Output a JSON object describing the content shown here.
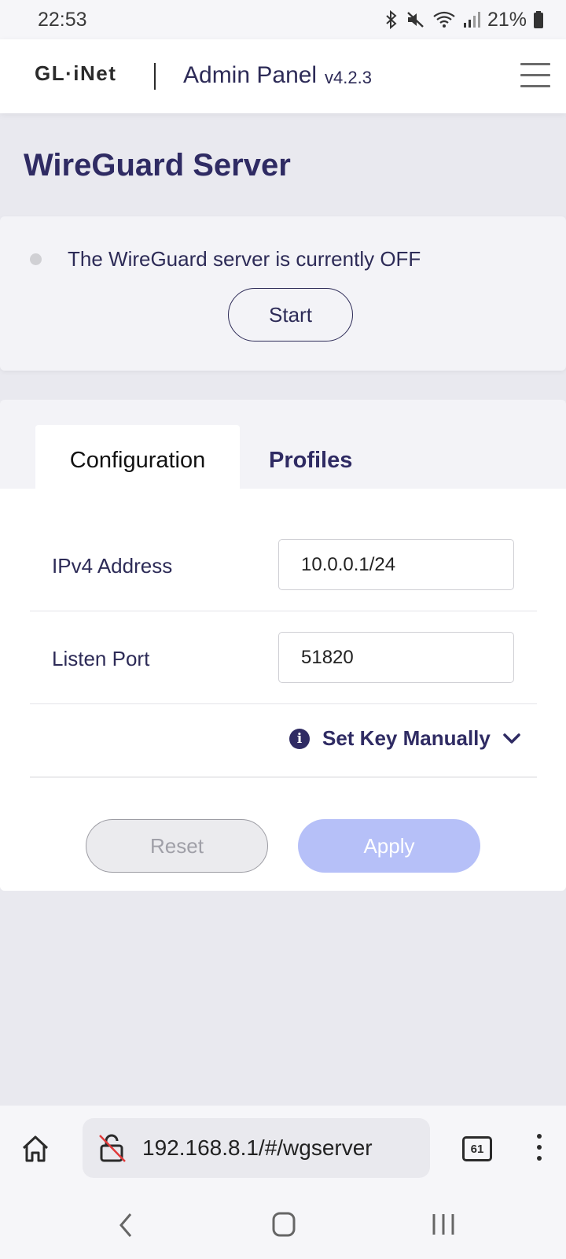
{
  "status_bar": {
    "time": "22:53",
    "battery": "21%",
    "icons": [
      "bluetooth-icon",
      "mute-icon",
      "wifi-icon",
      "signal-icon",
      "battery-icon"
    ]
  },
  "header": {
    "logo": "GL·iNet",
    "title": "Admin Panel",
    "version": "v4.2.3",
    "menu_icon": "hamburger-menu-icon"
  },
  "page": {
    "title": "WireGuard Server"
  },
  "server_status": {
    "text": "The WireGuard server is currently OFF",
    "indicator_color": "#d0d0d4",
    "start_label": "Start"
  },
  "tabs": [
    {
      "label": "Configuration",
      "active": true
    },
    {
      "label": "Profiles",
      "active": false
    }
  ],
  "config": {
    "ipv4_label": "IPv4 Address",
    "ipv4_value": "10.0.0.1/24",
    "port_label": "Listen Port",
    "port_value": "51820",
    "key_toggle_label": "Set Key Manually",
    "reset_label": "Reset",
    "apply_label": "Apply"
  },
  "browser": {
    "url": "192.168.8.1/#/wgserver",
    "tab_count": "61"
  },
  "colors": {
    "primary": "#2f2b63",
    "apply_disabled": "#b6c0f8",
    "background": "#e9e9ef"
  }
}
